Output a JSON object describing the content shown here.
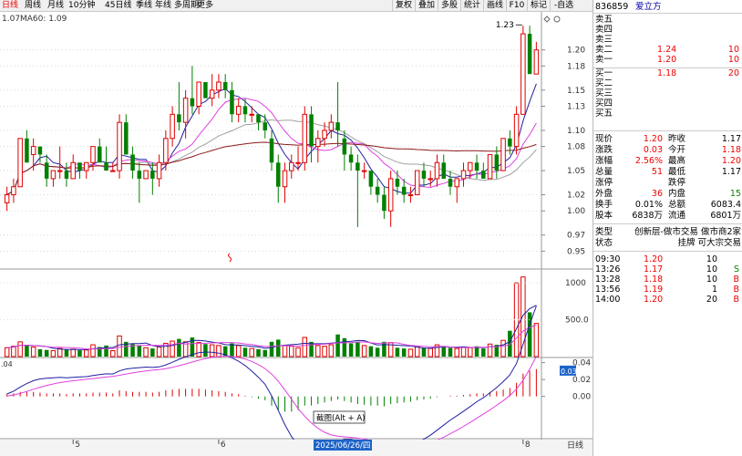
{
  "toolbar": {
    "periods": [
      {
        "label": "日线",
        "active": true
      },
      {
        "label": "周线",
        "active": false
      },
      {
        "label": "月线",
        "active": false
      },
      {
        "label": "10分钟",
        "active": false
      },
      {
        "label": "45日线",
        "active": false
      },
      {
        "label": "季线",
        "active": false
      },
      {
        "label": "年线",
        "active": false
      },
      {
        "label": "多周期",
        "active": false
      },
      {
        "label": "更多",
        "active": false
      }
    ],
    "buttons": [
      "复权",
      "叠加",
      "多股",
      "统计",
      "画线",
      "F10",
      "标记",
      "-自选"
    ]
  },
  "price_chart": {
    "ma_label": "MA60: 1.09",
    "left_value": "1.07",
    "high_annotation": "1.23",
    "y_ticks": [
      "1.20",
      "1.18",
      "1.15",
      "1.13",
      "1.10",
      "1.08",
      "1.05",
      "1.02",
      "1.00",
      "0.97",
      "0.95"
    ],
    "ylim": [
      0.93,
      1.245
    ]
  },
  "volume_chart": {
    "y_ticks": [
      "1000",
      "500.0"
    ],
    "ylim": [
      0,
      1150
    ]
  },
  "macd_chart": {
    "left_value": ".04",
    "y_ticks": [
      "0.04",
      "0.02",
      "0.00"
    ],
    "current_value": "0.03",
    "ylim": [
      -0.05,
      0.045
    ]
  },
  "x_axis": {
    "labels": [
      {
        "text": "5",
        "idx": 10
      },
      {
        "text": "6",
        "idx": 32
      },
      {
        "text": "8",
        "idx": 78
      }
    ],
    "highlight_date": "2025/06/26/四",
    "right_label": "日线",
    "tooltip": "截图(Alt + A)"
  },
  "chart_data": {
    "type": "candlestick",
    "ohlc": [
      [
        1.01,
        1.03,
        1.0,
        1.02
      ],
      [
        1.02,
        1.04,
        1.01,
        1.03
      ],
      [
        1.03,
        1.09,
        1.03,
        1.09
      ],
      [
        1.09,
        1.1,
        1.06,
        1.06
      ],
      [
        1.07,
        1.09,
        1.05,
        1.08
      ],
      [
        1.08,
        1.08,
        1.06,
        1.07
      ],
      [
        1.06,
        1.07,
        1.03,
        1.04
      ],
      [
        1.04,
        1.05,
        1.03,
        1.05
      ],
      [
        1.05,
        1.08,
        1.04,
        1.05
      ],
      [
        1.05,
        1.06,
        1.03,
        1.04
      ],
      [
        1.04,
        1.07,
        1.04,
        1.06
      ],
      [
        1.06,
        1.06,
        1.04,
        1.05
      ],
      [
        1.05,
        1.06,
        1.04,
        1.06
      ],
      [
        1.06,
        1.08,
        1.05,
        1.08
      ],
      [
        1.08,
        1.09,
        1.06,
        1.06
      ],
      [
        1.06,
        1.08,
        1.05,
        1.05
      ],
      [
        1.05,
        1.06,
        1.05,
        1.05
      ],
      [
        1.05,
        1.12,
        1.04,
        1.11
      ],
      [
        1.11,
        1.12,
        1.07,
        1.07
      ],
      [
        1.07,
        1.08,
        1.04,
        1.05
      ],
      [
        1.05,
        1.06,
        1.01,
        1.04
      ],
      [
        1.04,
        1.05,
        1.04,
        1.05
      ],
      [
        1.05,
        1.06,
        1.02,
        1.04
      ],
      [
        1.04,
        1.07,
        1.03,
        1.06
      ],
      [
        1.06,
        1.1,
        1.05,
        1.09
      ],
      [
        1.09,
        1.13,
        1.08,
        1.12
      ],
      [
        1.12,
        1.16,
        1.1,
        1.11
      ],
      [
        1.11,
        1.15,
        1.09,
        1.14
      ],
      [
        1.14,
        1.18,
        1.12,
        1.13
      ],
      [
        1.13,
        1.16,
        1.12,
        1.16
      ],
      [
        1.16,
        1.16,
        1.14,
        1.14
      ],
      [
        1.14,
        1.17,
        1.13,
        1.15
      ],
      [
        1.15,
        1.17,
        1.14,
        1.16
      ],
      [
        1.16,
        1.17,
        1.14,
        1.15
      ],
      [
        1.15,
        1.16,
        1.11,
        1.12
      ],
      [
        1.12,
        1.14,
        1.11,
        1.13
      ],
      [
        1.13,
        1.14,
        1.11,
        1.12
      ],
      [
        1.12,
        1.13,
        1.11,
        1.12
      ],
      [
        1.12,
        1.12,
        1.1,
        1.11
      ],
      [
        1.11,
        1.12,
        1.09,
        1.1
      ],
      [
        1.09,
        1.1,
        1.05,
        1.06
      ],
      [
        1.06,
        1.07,
        1.01,
        1.03
      ],
      [
        1.03,
        1.06,
        1.01,
        1.05
      ],
      [
        1.05,
        1.07,
        1.04,
        1.06
      ],
      [
        1.06,
        1.08,
        1.05,
        1.06
      ],
      [
        1.06,
        1.13,
        1.05,
        1.12
      ],
      [
        1.12,
        1.13,
        1.06,
        1.08
      ],
      [
        1.08,
        1.1,
        1.06,
        1.09
      ],
      [
        1.09,
        1.11,
        1.08,
        1.1
      ],
      [
        1.1,
        1.12,
        1.09,
        1.11
      ],
      [
        1.11,
        1.16,
        1.08,
        1.1
      ],
      [
        1.09,
        1.1,
        1.05,
        1.07
      ],
      [
        1.07,
        1.08,
        1.05,
        1.06
      ],
      [
        1.06,
        1.07,
        0.98,
        1.05
      ],
      [
        1.05,
        1.06,
        1.04,
        1.05
      ],
      [
        1.05,
        1.05,
        1.02,
        1.03
      ],
      [
        1.03,
        1.04,
        1.01,
        1.02
      ],
      [
        1.02,
        1.03,
        0.99,
        1.0
      ],
      [
        1.0,
        1.05,
        0.98,
        1.04
      ],
      [
        1.04,
        1.05,
        1.02,
        1.03
      ],
      [
        1.03,
        1.04,
        1.01,
        1.02
      ],
      [
        1.02,
        1.03,
        1.01,
        1.02
      ],
      [
        1.02,
        1.05,
        1.02,
        1.05
      ],
      [
        1.05,
        1.06,
        1.03,
        1.04
      ],
      [
        1.04,
        1.05,
        1.03,
        1.04
      ],
      [
        1.04,
        1.07,
        1.03,
        1.06
      ],
      [
        1.06,
        1.07,
        1.04,
        1.04
      ],
      [
        1.04,
        1.05,
        1.02,
        1.03
      ],
      [
        1.03,
        1.04,
        1.01,
        1.04
      ],
      [
        1.04,
        1.06,
        1.03,
        1.05
      ],
      [
        1.05,
        1.06,
        1.04,
        1.06
      ],
      [
        1.06,
        1.07,
        1.04,
        1.05
      ],
      [
        1.05,
        1.06,
        1.04,
        1.04
      ],
      [
        1.04,
        1.07,
        1.04,
        1.07
      ],
      [
        1.07,
        1.08,
        1.04,
        1.05
      ],
      [
        1.05,
        1.09,
        1.05,
        1.09
      ],
      [
        1.09,
        1.1,
        1.07,
        1.08
      ],
      [
        1.08,
        1.13,
        1.07,
        1.12
      ],
      [
        1.12,
        1.23,
        1.12,
        1.22
      ],
      [
        1.22,
        1.23,
        1.17,
        1.17
      ],
      [
        1.17,
        1.21,
        1.17,
        1.2
      ]
    ],
    "volume": [
      120,
      140,
      200,
      160,
      130,
      100,
      90,
      80,
      110,
      95,
      100,
      85,
      90,
      160,
      130,
      150,
      80,
      280,
      200,
      170,
      150,
      120,
      110,
      130,
      180,
      210,
      240,
      200,
      260,
      190,
      170,
      160,
      150,
      140,
      180,
      150,
      120,
      110,
      100,
      90,
      200,
      230,
      150,
      140,
      120,
      260,
      200,
      150,
      140,
      160,
      300,
      250,
      180,
      200,
      150,
      140,
      120,
      200,
      190,
      120,
      110,
      100,
      130,
      120,
      110,
      160,
      140,
      120,
      110,
      130,
      120,
      140,
      110,
      170,
      160,
      220,
      350,
      1000,
      1080,
      600,
      450
    ],
    "vol_dir": [
      1,
      1,
      1,
      0,
      1,
      0,
      0,
      1,
      1,
      0,
      1,
      0,
      1,
      1,
      0,
      0,
      1,
      1,
      0,
      0,
      0,
      1,
      0,
      1,
      1,
      1,
      0,
      1,
      0,
      1,
      0,
      1,
      1,
      0,
      0,
      1,
      0,
      1,
      0,
      0,
      0,
      0,
      1,
      1,
      1,
      1,
      0,
      1,
      1,
      1,
      0,
      0,
      0,
      0,
      1,
      0,
      0,
      0,
      1,
      0,
      0,
      1,
      1,
      0,
      1,
      1,
      0,
      0,
      1,
      1,
      1,
      0,
      0,
      1,
      0,
      1,
      0,
      1,
      1,
      0,
      1
    ],
    "macd_hist": [
      0.003,
      0.004,
      0.006,
      0.006,
      0.006,
      0.005,
      0.004,
      0.004,
      0.004,
      0.003,
      0.004,
      0.004,
      0.004,
      0.005,
      0.005,
      0.005,
      0.004,
      0.008,
      0.007,
      0.006,
      0.006,
      0.006,
      0.005,
      0.006,
      0.008,
      0.009,
      0.01,
      0.01,
      0.01,
      0.01,
      0.009,
      0.008,
      0.007,
      0.006,
      0.004,
      0.003,
      0.001,
      -0.001,
      -0.003,
      -0.005,
      -0.012,
      -0.018,
      -0.02,
      -0.02,
      -0.018,
      -0.012,
      -0.012,
      -0.01,
      -0.008,
      -0.006,
      -0.004,
      -0.006,
      -0.008,
      -0.01,
      -0.011,
      -0.012,
      -0.012,
      -0.013,
      -0.01,
      -0.009,
      -0.008,
      -0.007,
      -0.005,
      -0.004,
      -0.003,
      -0.001,
      0.0,
      0.001,
      0.001,
      0.002,
      0.003,
      0.004,
      0.004,
      0.006,
      0.007,
      0.009,
      0.011,
      0.018,
      0.03,
      0.034,
      0.036
    ]
  },
  "stock": {
    "code": "836859",
    "name": "爱立方"
  },
  "order_book": {
    "asks": [
      {
        "label": "卖五",
        "price": "",
        "vol": ""
      },
      {
        "label": "卖四",
        "price": "",
        "vol": ""
      },
      {
        "label": "卖三",
        "price": "",
        "vol": ""
      },
      {
        "label": "卖二",
        "price": "1.24",
        "vol": "10"
      },
      {
        "label": "卖一",
        "price": "1.20",
        "vol": "10"
      }
    ],
    "bids": [
      {
        "label": "买一",
        "price": "1.18",
        "vol": "20"
      },
      {
        "label": "买二",
        "price": "",
        "vol": ""
      },
      {
        "label": "买三",
        "price": "",
        "vol": ""
      },
      {
        "label": "买四",
        "price": "",
        "vol": ""
      },
      {
        "label": "买五",
        "price": "",
        "vol": ""
      }
    ]
  },
  "quote": [
    {
      "l1": "现价",
      "v1": "1.20",
      "c1": "red",
      "l2": "昨收",
      "v2": "1.17",
      "c2": ""
    },
    {
      "l1": "涨跌",
      "v1": "0.03",
      "c1": "red",
      "l2": "今开",
      "v2": "1.18",
      "c2": "red"
    },
    {
      "l1": "涨幅",
      "v1": "2.56%",
      "c1": "red",
      "l2": "最高",
      "v2": "1.20",
      "c2": "red"
    },
    {
      "l1": "总量",
      "v1": "51",
      "c1": "red",
      "l2": "最低",
      "v2": "1.17",
      "c2": ""
    },
    {
      "l1": "涨停",
      "v1": "",
      "c1": "",
      "l2": "跌停",
      "v2": "",
      "c2": ""
    },
    {
      "l1": "外盘",
      "v1": "36",
      "c1": "red",
      "l2": "内盘",
      "v2": "15",
      "c2": "green"
    },
    {
      "l1": "换手",
      "v1": "0.01%",
      "c1": "",
      "l2": "总额",
      "v2": "6083.4",
      "c2": ""
    },
    {
      "l1": "股本",
      "v1": "6838万",
      "c1": "",
      "l2": "流通",
      "v2": "6801万",
      "c2": ""
    }
  ],
  "info": [
    {
      "label": "类型",
      "value": "创新层-做市交易 做市商2家"
    },
    {
      "label": "状态",
      "value": "挂牌 可大宗交易"
    }
  ],
  "ticks": [
    {
      "time": "09:30",
      "price": "1.20",
      "vol": "10",
      "side": ""
    },
    {
      "time": "13:26",
      "price": "1.17",
      "vol": "10",
      "side": "S"
    },
    {
      "time": "13:28",
      "price": "1.18",
      "vol": "10",
      "side": "B"
    },
    {
      "time": "13:56",
      "price": "1.19",
      "vol": "1",
      "side": "B"
    },
    {
      "time": "14:00",
      "price": "1.20",
      "vol": "20",
      "side": "B"
    }
  ],
  "colors": {
    "up": "#e00000",
    "down": "#008000",
    "ma5": "#2020a0",
    "ma10": "#e040e0",
    "ma20": "#a0a0a0",
    "ma60": "#8b1a1a"
  }
}
